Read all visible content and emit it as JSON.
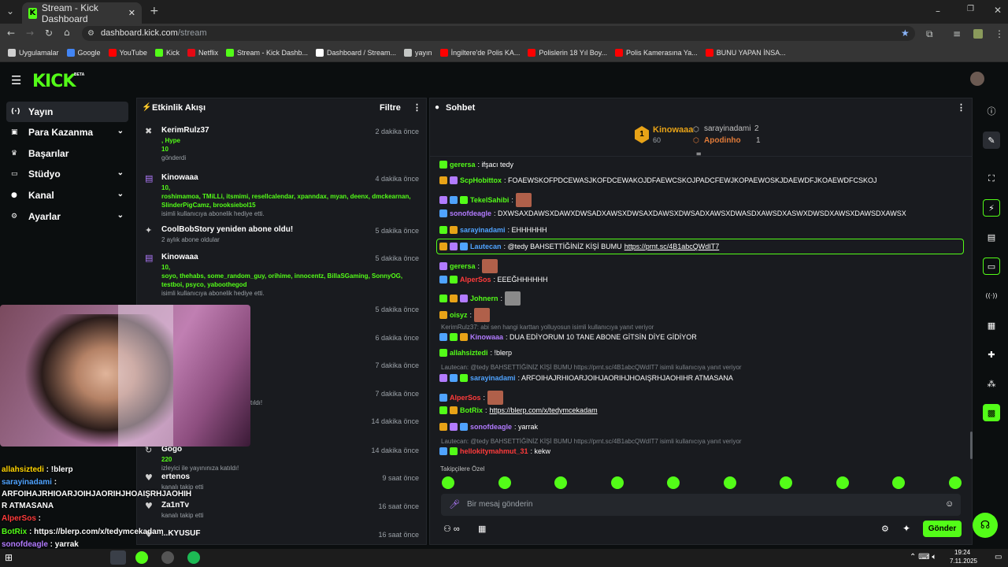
{
  "browser": {
    "tab_title": "Stream - Kick Dashboard",
    "url_domain": "dashboard.kick.com",
    "url_path": "/stream",
    "bookmarks": [
      {
        "label": "Uygulamalar",
        "color": "#d0d0d0"
      },
      {
        "label": "Google",
        "color": "#4285f4"
      },
      {
        "label": "YouTube",
        "color": "#ff0000"
      },
      {
        "label": "Kick",
        "color": "#53fc18"
      },
      {
        "label": "Netflix",
        "color": "#e50914"
      },
      {
        "label": "Stream - Kick Dashb...",
        "color": "#53fc18"
      },
      {
        "label": "Dashboard / Stream...",
        "color": "#ffffff"
      },
      {
        "label": "yayın",
        "color": "#c4c7c5"
      },
      {
        "label": "İngiltere'de Polis KA...",
        "color": "#ff0000"
      },
      {
        "label": "Polislerin 18 Yıl Boy...",
        "color": "#ff0000"
      },
      {
        "label": "Polis Kamerasına Ya...",
        "color": "#ff0000"
      },
      {
        "label": "BUNU YAPAN İNSA...",
        "color": "#ff0000"
      }
    ]
  },
  "header": {
    "logo": "KICK",
    "beta": "BETA"
  },
  "sidebar": {
    "items": [
      {
        "label": "Yayın",
        "icon": "broadcast-icon",
        "has_chevron": false
      },
      {
        "label": "Para Kazanma",
        "icon": "money-icon",
        "has_chevron": true
      },
      {
        "label": "Başarılar",
        "icon": "trophy-icon",
        "has_chevron": false
      },
      {
        "label": "Stüdyo",
        "icon": "monitor-icon",
        "has_chevron": true
      },
      {
        "label": "Kanal",
        "icon": "user-icon",
        "has_chevron": true
      },
      {
        "label": "Ayarlar",
        "icon": "gear-icon",
        "has_chevron": true
      }
    ]
  },
  "activity": {
    "title": "Etkinlik Akışı",
    "filter": "Filtre",
    "events": [
      {
        "user": "KerimRulz37",
        "time": "2 dakika önce",
        "line1": ", Hype",
        "line2": "10",
        "sub": "gönderdi"
      },
      {
        "user": "Kinowaaa",
        "time": "4 dakika önce",
        "line1": "10,",
        "line2": "roshimamoa, TMiLLi, itsmimi, resellcalendar, xpanndax, myan, deenx, dmckearnan, SlinderPigCamz, brooksiebol15",
        "sub": "isimli kullanıcıya abonelik hediye etti."
      },
      {
        "user": "CoolBobStory yeniden abone oldu!",
        "time": "5 dakika önce",
        "sub": "2 aylık abone oldular"
      },
      {
        "user": "Kinowaaa",
        "time": "5 dakika önce",
        "line1": "10,",
        "line2": "soyo, thehabs, some_random_guy, orihime, innocentz, BillaSGaming, SonnyOG, testboi, psyco, yaboothegod",
        "sub": "isimli kullanıcıya abonelik hediye etti."
      },
      {
        "time": "5 dakika önce"
      },
      {
        "time": "6 dakika önce"
      },
      {
        "time": "7 dakika önce"
      },
      {
        "time": "7 dakika önce",
        "sub": "tıldı!"
      },
      {
        "time": "14 dakika önce"
      },
      {
        "user": "Gogo",
        "time": "14 dakika önce",
        "line1": "220",
        "sub": "izleyici ile yayınınıza katıldı!"
      },
      {
        "user": "ertenos",
        "time": "9 saat önce",
        "sub": "kanalı takip etti"
      },
      {
        "user": "Za1nTv",
        "time": "16 saat önce",
        "sub": "kanalı takip etti"
      },
      {
        "user": "...KYUSUF",
        "time": "16 saat önce"
      }
    ]
  },
  "chat": {
    "title": "Sohbet",
    "leaderboard": {
      "first_name": "Kinowaaa",
      "first_value": "60",
      "second_name": "sarayinadami",
      "second_value": "2",
      "third_name": "Apodinho",
      "third_value": "1"
    },
    "messages": [
      {
        "user": "gerersa",
        "color": "#53fc18",
        "text": ": ifşacı tedy"
      },
      {
        "user": "ScpHobittox",
        "color": "#53fc18",
        "text": ": FOAEWSKOFPDCEWASJKOFDCEWAKOJDFAEWCSKOJPADCFEWJKOPAEWOSKJDAEWDFJKOAEWDFCSKOJ"
      },
      {
        "user": "TekelSahibi",
        "color": "#53fc18",
        "text": ":"
      },
      {
        "user": "sonofdeagle",
        "color": "#b27bff",
        "text": ": DXWSAXDAWSXDAWXDWSADXAWSXDWSAXDAWSXDWSADXAWSXDWASDXAWSDXASWXDWSDXAWSXDAWSDXAWSX"
      },
      {
        "user": "sarayinadami",
        "color": "#4fa3ff",
        "text": ": EHHHHHH"
      },
      {
        "user": "Lautecan",
        "color": "#4fa3ff",
        "text": ": @tedy BAHSETTİĞİNİZ KİŞİ BUMU ",
        "link": "https://prnt.sc/4B1abcQWdIT7"
      },
      {
        "user": "gerersa",
        "color": "#53fc18",
        "text": ":"
      },
      {
        "user": "AlperSos",
        "color": "#ff3b3b",
        "text": ": EEEĞHHHHHH"
      },
      {
        "user": "Johnern",
        "color": "#53fc18",
        "text": ":"
      },
      {
        "user": "oisyz",
        "color": "#53fc18",
        "text": ":"
      },
      {
        "reply": "KerimRulz37: abi sen hangi karttan yolluyosun isimli kullanıcıya yanıt veriyor"
      },
      {
        "user": "Kinowaaa",
        "color": "#b27bff",
        "text": ": DUA EDİYORUM 10 TANE ABONE GİTSİN DİYE GİDİYOR"
      },
      {
        "user": "allahsiztedi",
        "color": "#53fc18",
        "text": ": !blerp"
      },
      {
        "reply": "Lautecan: @tedy BAHSETTİĞİNİZ KİŞİ BUMU https://prnt.sc/4B1abcQWdIT7 isimli kullanıcıya yanıt veriyor"
      },
      {
        "user": "sarayinadami",
        "color": "#4fa3ff",
        "text": ": ARFOIHAJRHIOARJOIHJAORIHJHOAIŞRHJAOHIHR ATMASANA"
      },
      {
        "user": "AlperSos",
        "color": "#ff3b3b",
        "text": ":"
      },
      {
        "user": "BotRix",
        "color": "#53fc18",
        "text": ": ",
        "link": "https://blerp.com/x/tedymcekadam"
      },
      {
        "user": "sonofdeagle",
        "color": "#b27bff",
        "text": ": yarrak"
      },
      {
        "reply": "Lautecan: @tedy BAHSETTİĞİNİZ KİŞİ BUMU https://prnt.sc/4B1abcQWdIT7 isimli kullanıcıya yanıt veriyor"
      },
      {
        "user": "hellokitymahmut_31",
        "color": "#ff3b3b",
        "text": ": kekw"
      }
    ],
    "emote_section": "Takipçilere Özel",
    "input_placeholder": "Bir mesaj gönderin",
    "send_label": "Gönder"
  },
  "overlay_chat": {
    "lines": [
      {
        "user": "allahsiztedi",
        "text": " : !blerp",
        "color": "#ffd400"
      },
      {
        "user": "sarayinadami",
        "text": " :",
        "color": "#4fa3ff"
      },
      {
        "text": "ARFOIHAJRHIOARJOIHJAORIHJHOAIŞRHJAOHIH",
        "color": "#ffffff"
      },
      {
        "text": "R ATMASANA",
        "color": "#ffffff"
      },
      {
        "user": "AlperSos",
        "text": " :",
        "color": "#ff3b3b"
      },
      {
        "user": "BotRix",
        "text": " : https://blerp.com/x/tedymcekadam",
        "color": "#53fc18"
      },
      {
        "user": "sonofdeagle",
        "text": " : yarrak",
        "color": "#b27bff"
      },
      {
        "user": "hellokitymahmut_31",
        "text": " : kekw",
        "color": "#ff3b3b"
      }
    ]
  },
  "taskbar": {
    "time": "19:24",
    "date": "7.11.2025"
  },
  "colors": {
    "accent": "#53fc18",
    "panel": "#191b1f",
    "bg": "#0b0e0f"
  }
}
